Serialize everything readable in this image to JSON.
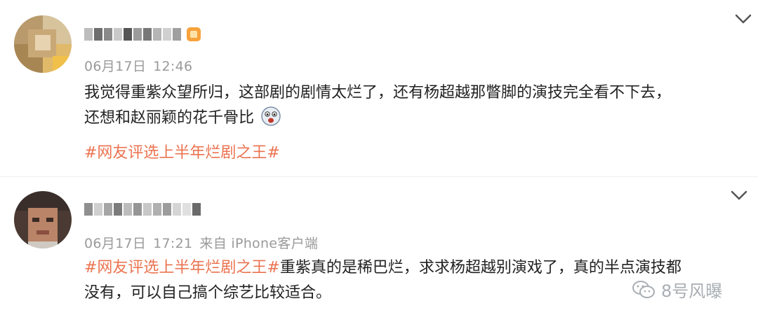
{
  "posts": [
    {
      "username": "",
      "date": "06月17日",
      "time": "12:46",
      "source": "",
      "text_line1": "我觉得重紫众望所归，这部剧的剧情太烂了，还有杨超越那瞥脚的演技完全看不下去，",
      "text_line2": "还想和赵丽颖的花千骨比",
      "hashtag": "#网友评选上半年烂剧之王#"
    },
    {
      "username": "",
      "date": "06月17日",
      "time": "17:21",
      "source": "来自 iPhone客户端",
      "hashtag": "#网友评选上半年烂剧之王#",
      "text_line1": "重紫真的是稀巴烂，求求杨超越别演戏了，真的半点演技都",
      "text_line2": "没有，可以自己搞个综艺比较适合。"
    }
  ],
  "watermark": {
    "text": "8号风曝",
    "icon": "wechat-icon"
  },
  "icons": {
    "chevron": "chevron-down-icon",
    "emoji": "emoji-face-icon",
    "vip": "vip-badge-icon"
  },
  "colors": {
    "hashtag": "#eb7350",
    "meta": "#9a9a9a",
    "text": "#222222"
  }
}
